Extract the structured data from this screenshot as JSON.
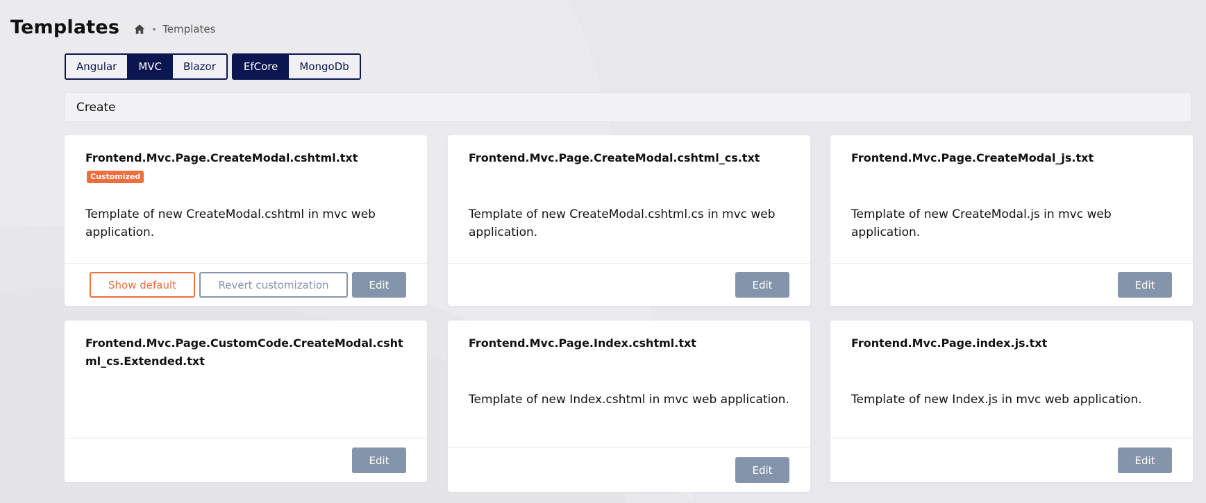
{
  "header": {
    "title": "Templates",
    "breadcrumb": {
      "current": "Templates"
    }
  },
  "ui_toggles": {
    "tabs": [
      {
        "label": "Angular",
        "active": false
      },
      {
        "label": "MVC",
        "active": true
      },
      {
        "label": "Blazor",
        "active": false
      }
    ],
    "db": [
      {
        "label": "EfCore",
        "active": true
      },
      {
        "label": "MongoDb",
        "active": false
      }
    ]
  },
  "section": {
    "title": "Create"
  },
  "cards": [
    {
      "title": "Frontend.Mvc.Page.CreateModal.cshtml.txt",
      "badge": "Customized",
      "description": "Template of new CreateModal.cshtml in mvc web application.",
      "show_default_label": "Show default",
      "revert_label": "Revert customization",
      "edit_label": "Edit"
    },
    {
      "title": "Frontend.Mvc.Page.CreateModal.cshtml_cs.txt",
      "description": "Template of new CreateModal.cshtml.cs in mvc web application.",
      "edit_label": "Edit"
    },
    {
      "title": "Frontend.Mvc.Page.CreateModal_js.txt",
      "description": "Template of new CreateModal.js in mvc web application.",
      "edit_label": "Edit"
    },
    {
      "title": "Frontend.Mvc.Page.CustomCode.CreateModal.cshtml_cs.Extended.txt",
      "description": "",
      "edit_label": "Edit"
    },
    {
      "title": "Frontend.Mvc.Page.Index.cshtml.txt",
      "description": "Template of new Index.cshtml in mvc web application.",
      "edit_label": "Edit"
    },
    {
      "title": "Frontend.Mvc.Page.index.js.txt",
      "description": "Template of new Index.js in mvc web application.",
      "edit_label": "Edit"
    }
  ],
  "colors": {
    "primary": "#0b1650",
    "accent": "#f06d3e",
    "edit_button": "#8494aa",
    "background": "#ebebee"
  }
}
